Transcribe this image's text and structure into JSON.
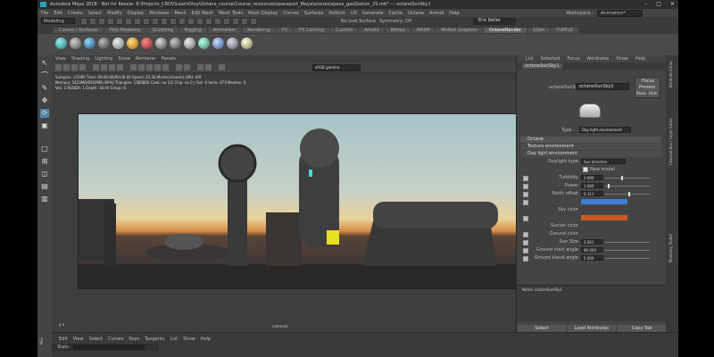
{
  "window": {
    "title": "Autodesk Maya 2018 - Not for Resale: R:\\Projects_CROV\\LearnOtoy\\Octane_course\\Course_resources\\spaceport_Maya\\scenes\\space_gasStation_25.mb* --- octaneSunSky1",
    "controls": [
      "–",
      "□",
      "✕"
    ]
  },
  "menubar": {
    "items": [
      "File",
      "Edit",
      "Create",
      "Select",
      "Modify",
      "Display",
      "Windows",
      "Mesh",
      "Edit Mesh",
      "Mesh Tools",
      "Mesh Display",
      "Curves",
      "Surfaces",
      "Deform",
      "UV",
      "Generate",
      "Cache",
      "Octane",
      "Arnold",
      "Help"
    ],
    "workspace_label": "Workspace :",
    "workspace_value": "Animation*"
  },
  "statusline": {
    "mode": "Modeling",
    "no_live_surface": "No Live Surface",
    "symmetry": "Symmetry: Off",
    "user": "Eric Keller"
  },
  "shelf": {
    "tabs": [
      "Curves / Surfaces",
      "Poly Modeling",
      "Sculpting",
      "Rigging",
      "Animation",
      "Rendering",
      "FX",
      "FX Caching",
      "Custom",
      "Arnold",
      "Bifrost",
      "MASH",
      "Motion Graphics",
      "OctaneRender",
      "XGen",
      "TURTLE"
    ],
    "active_tab": "OctaneRender"
  },
  "viewport": {
    "menu": [
      "View",
      "Shading",
      "Lighting",
      "Show",
      "Renderer",
      "Panels"
    ],
    "gamma_label": "sRGB gamma",
    "stats": [
      "Samples: 1/1000  Time: 00:00:00/00:00:00  Speed: 23.36 Ms/sec/s(norm)  GPU: 0/0",
      "Memory: 5423MB/8192MB (86%)  Triangles: 1066802  Cook: no  1/2 Chip: no  0 | Out: 0 Verts: 473  Meshes: 0",
      "Ves: 1 RGBDA: 1  Depth: 16  All Group: 6"
    ],
    "camera_label": "camera1",
    "axis_label": "y x"
  },
  "attribute_editor": {
    "menu": [
      "List",
      "Selected",
      "Focus",
      "Attributes",
      "Show",
      "Help"
    ],
    "tab": "octaneSunSky1",
    "node_label": "octaneSunSky:",
    "node_value": "octaneSunSky1",
    "focus_label": "Focus",
    "presets_label": "Presets",
    "show_label": "Show",
    "hide_label": "Hide",
    "type_label": "Type",
    "type_value": "Day light environment",
    "sections": [
      "Octane",
      "Texture environment",
      "Day light environment"
    ],
    "daylight_type_label": "Daylight type",
    "daylight_type_value": "Sun direction",
    "new_model_label": "New model",
    "attrs": [
      {
        "label": "Turbidity",
        "value": "2.000",
        "fraction": 0.35
      },
      {
        "label": "Power",
        "value": "1.000",
        "fraction": 0.05
      },
      {
        "label": "North offset",
        "value": "0.111",
        "fraction": 0.52
      }
    ],
    "sky_color_label": "Sky color",
    "sky_color": "#3b7fd6",
    "sunset_color_label": "Sunset color",
    "sunset_color": "#c85a25",
    "ground_color_label": "Ground color",
    "sun_size_label": "Sun Size",
    "sun_size_value": "2.061",
    "ground_start_label": "Ground start angle",
    "ground_start_value": "90.000",
    "ground_blend_label": "Ground blend angle",
    "ground_blend_value": "5.000",
    "notes_label": "Notes: octaneSunSky1",
    "buttons": [
      "Select",
      "Load Attributes",
      "Copy Tab"
    ]
  },
  "side_tabs": [
    "Attribute Editor",
    "Channel Box / Layer Editor",
    "Modeling Toolkit"
  ],
  "timebar": {
    "menu": [
      "Edit",
      "View",
      "Select",
      "Curves",
      "Keys",
      "Tangents",
      "List",
      "Show",
      "Help"
    ],
    "stats_label": "Stats",
    "mel_label": "MEL"
  },
  "colors": {
    "accent": "#2aa3b3",
    "panel": "#444444",
    "dark": "#2b2b2b"
  }
}
